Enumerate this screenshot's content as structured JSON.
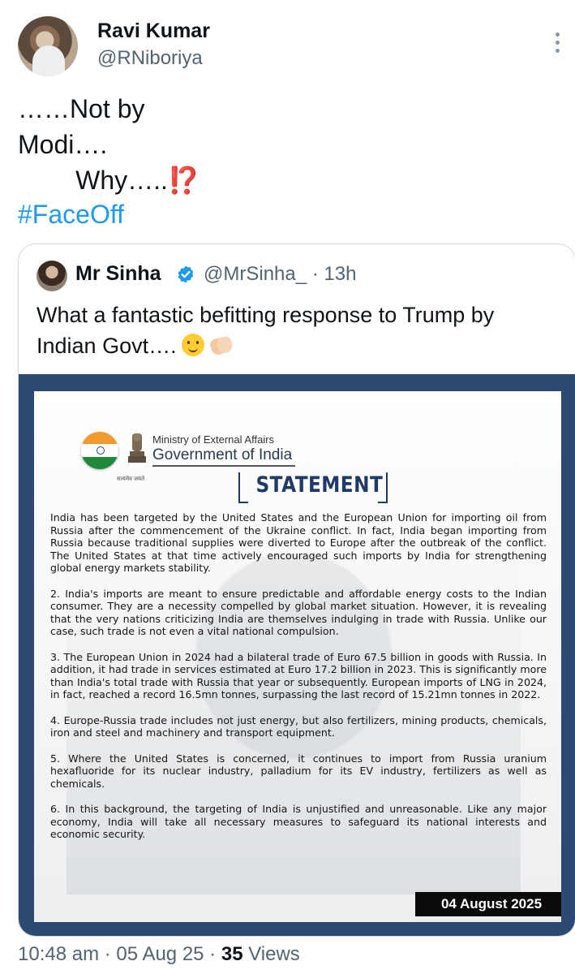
{
  "author": {
    "name": "Ravi Kumar",
    "handle": "@RNiboriya"
  },
  "tweet": {
    "line1": "……Not by",
    "line2": "Modi….",
    "line3": "        Why…..⁉️",
    "hashtag": "#FaceOff"
  },
  "quote": {
    "name": "Mr Sinha",
    "handle": "@MrSinha_",
    "time": "13h",
    "text": "What a fantastic befitting response to Trump by Indian Govt…."
  },
  "document": {
    "ministry": "Ministry of External Affairs",
    "government": "Government of India",
    "emblem_caption": "सत्यमेव जयते",
    "title": "STATEMENT",
    "paragraphs": [
      "India has been targeted by the United States and the European Union for importing oil from Russia after the commencement of the Ukraine conflict. In fact, India began importing from Russia because traditional supplies were diverted to Europe after the outbreak of the conflict. The United States at that time actively encouraged such imports by India for strengthening global energy markets stability.",
      "2. India's imports are meant to ensure predictable and affordable energy costs to the Indian consumer. They are a necessity compelled by global market situation. However, it is revealing that the very nations criticizing India are themselves indulging in trade with Russia. Unlike our case, such trade is not even a vital national compulsion.",
      "3. The European Union in 2024 had a bilateral trade of Euro 67.5 billion in goods with Russia. In addition, it had trade in services estimated at Euro 17.2 billion in 2023. This is significantly more than India's total trade with Russia that year or subsequently. European imports of LNG in 2024, in fact, reached a record 16.5mn tonnes, surpassing the last record of 15.21mn tonnes in 2022.",
      "4. Europe-Russia trade includes not just energy, but also fertilizers, mining products, chemicals, iron and steel and machinery and transport equipment.",
      "5. Where the United States is concerned, it continues to import from Russia uranium hexafluoride for its nuclear industry, palladium for its EV industry, fertilizers as well as chemicals.",
      "6. In this background, the targeting of India is unjustified and unreasonable. Like any major economy, India will take all necessary measures to safeguard its national interests and economic security."
    ],
    "date": "04 August 2025"
  },
  "footer": {
    "time": "10:48 am",
    "date": "05 Aug 25",
    "views_count": "35",
    "views_label": "Views"
  },
  "colors": {
    "link": "#1d9bf0",
    "secondary_text": "#536471",
    "verified": "#1d9bf0",
    "doc_frame": "#2b4a72",
    "title_blue": "#1f3a66"
  },
  "icons": [
    "more-icon",
    "verified-badge-icon",
    "smile-emoji",
    "clap-emoji",
    "flag-emblem",
    "national-emblem"
  ]
}
